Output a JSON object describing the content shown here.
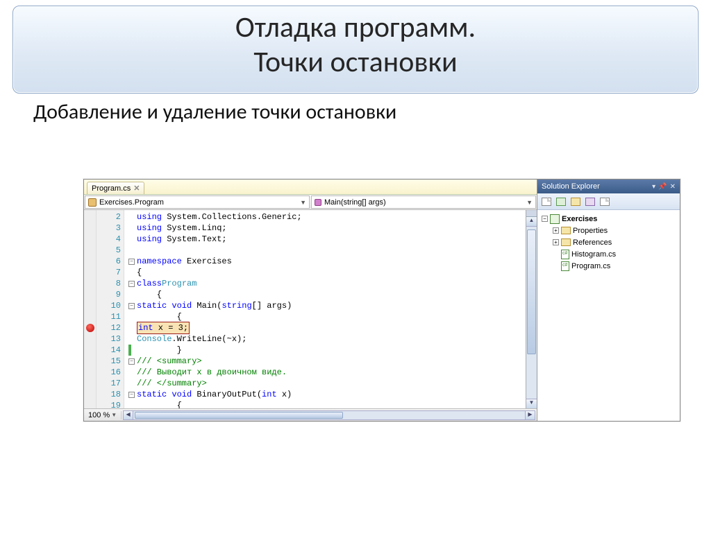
{
  "slide": {
    "title_line1": "Отладка программ.",
    "title_line2": "Точки остановки",
    "subtitle": "Добавление и удаление точки остановки"
  },
  "ide": {
    "tab": {
      "label": "Program.cs",
      "close": "✕"
    },
    "class_dropdown": "Exercises.Program",
    "member_dropdown": "Main(string[] args)",
    "zoom": "100 %",
    "lines": [
      {
        "n": 2,
        "indent": 0,
        "outline": "",
        "tokens": [
          [
            "kw",
            "using"
          ],
          [
            "",
            " System.Collections.Generic;"
          ]
        ]
      },
      {
        "n": 3,
        "indent": 0,
        "outline": "",
        "tokens": [
          [
            "kw",
            "using"
          ],
          [
            "",
            " System.Linq;"
          ]
        ]
      },
      {
        "n": 4,
        "indent": 0,
        "outline": "",
        "tokens": [
          [
            "kw",
            "using"
          ],
          [
            "",
            " System.Text;"
          ]
        ]
      },
      {
        "n": 5,
        "indent": 0,
        "outline": "",
        "tokens": [
          [
            "",
            ""
          ]
        ]
      },
      {
        "n": 6,
        "indent": 0,
        "outline": "-",
        "tokens": [
          [
            "kw",
            "namespace"
          ],
          [
            "",
            " Exercises"
          ]
        ]
      },
      {
        "n": 7,
        "indent": 0,
        "outline": "",
        "tokens": [
          [
            "",
            "{"
          ]
        ]
      },
      {
        "n": 8,
        "indent": 1,
        "outline": "-",
        "tokens": [
          [
            "kw",
            "class"
          ],
          [
            "",
            " "
          ],
          [
            "type",
            "Program"
          ]
        ]
      },
      {
        "n": 9,
        "indent": 1,
        "outline": "",
        "tokens": [
          [
            "",
            "{"
          ]
        ]
      },
      {
        "n": 10,
        "indent": 2,
        "outline": "-",
        "tokens": [
          [
            "kw",
            "static void"
          ],
          [
            "",
            " Main("
          ],
          [
            "kw",
            "string"
          ],
          [
            "",
            "[] args)"
          ]
        ]
      },
      {
        "n": 11,
        "indent": 2,
        "outline": "",
        "tokens": [
          [
            "",
            "{"
          ]
        ]
      },
      {
        "n": 12,
        "indent": 3,
        "outline": "",
        "bp": true,
        "hl": "int x = 3;"
      },
      {
        "n": 13,
        "indent": 3,
        "outline": "",
        "tokens": [
          [
            "type",
            "Console"
          ],
          [
            "",
            ".WriteLine(~x);"
          ]
        ]
      },
      {
        "n": 14,
        "indent": 2,
        "outline": "",
        "marker": true,
        "tokens": [
          [
            "",
            "}"
          ]
        ]
      },
      {
        "n": 15,
        "indent": 2,
        "outline": "-",
        "tokens": [
          [
            "cm",
            "/// <summary>"
          ]
        ]
      },
      {
        "n": 16,
        "indent": 2,
        "outline": "",
        "tokens": [
          [
            "cm",
            "/// Выводит x в двоичном виде."
          ]
        ]
      },
      {
        "n": 17,
        "indent": 2,
        "outline": "",
        "tokens": [
          [
            "cm",
            "/// </summary>"
          ]
        ]
      },
      {
        "n": 18,
        "indent": 2,
        "outline": "-",
        "tokens": [
          [
            "kw",
            "static void"
          ],
          [
            "",
            " BinaryOutPut("
          ],
          [
            "kw",
            "int"
          ],
          [
            "",
            " x)"
          ]
        ]
      },
      {
        "n": 19,
        "indent": 2,
        "outline": "",
        "tokens": [
          [
            "",
            "{"
          ]
        ]
      }
    ]
  },
  "solution_explorer": {
    "title": "Solution Explorer",
    "tree": [
      {
        "kind": "project",
        "label": "Exercises",
        "expand": "-",
        "bold": true
      },
      {
        "kind": "folder",
        "label": "Properties",
        "expand": "+",
        "indent": 1
      },
      {
        "kind": "folder",
        "label": "References",
        "expand": "+",
        "indent": 1
      },
      {
        "kind": "csfile",
        "label": "Histogram.cs",
        "expand": "",
        "indent": 1
      },
      {
        "kind": "csfile",
        "label": "Program.cs",
        "expand": "",
        "indent": 1
      }
    ]
  }
}
